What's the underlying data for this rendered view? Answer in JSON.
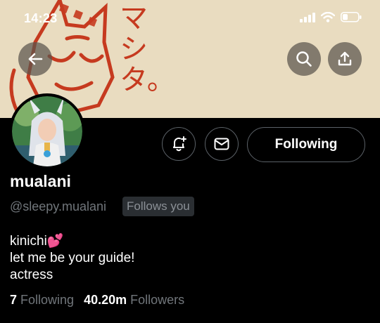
{
  "status_bar": {
    "time": "14:23"
  },
  "banner": {
    "calligraphy": "マシタ。",
    "accent_color": "#c63a1f"
  },
  "profile": {
    "display_name": "mualani",
    "handle": "@sleepy.mualani",
    "follows_you": "Follows you",
    "follow_button": "Following",
    "bio_lines": [
      "kinichi💕",
      "let me be your guide!",
      "actress"
    ],
    "following_count": "7",
    "following_label": "Following",
    "followers_count": "40.20m",
    "followers_label": "Followers"
  },
  "icons": {
    "back": "arrow-left-icon",
    "search": "search-icon",
    "share": "share-icon",
    "notify": "bell-plus-icon",
    "message": "mail-icon"
  },
  "colors": {
    "background": "#000000",
    "muted_text": "#71767b",
    "banner": "#e9dcc0",
    "button_border": "#5b6167"
  }
}
